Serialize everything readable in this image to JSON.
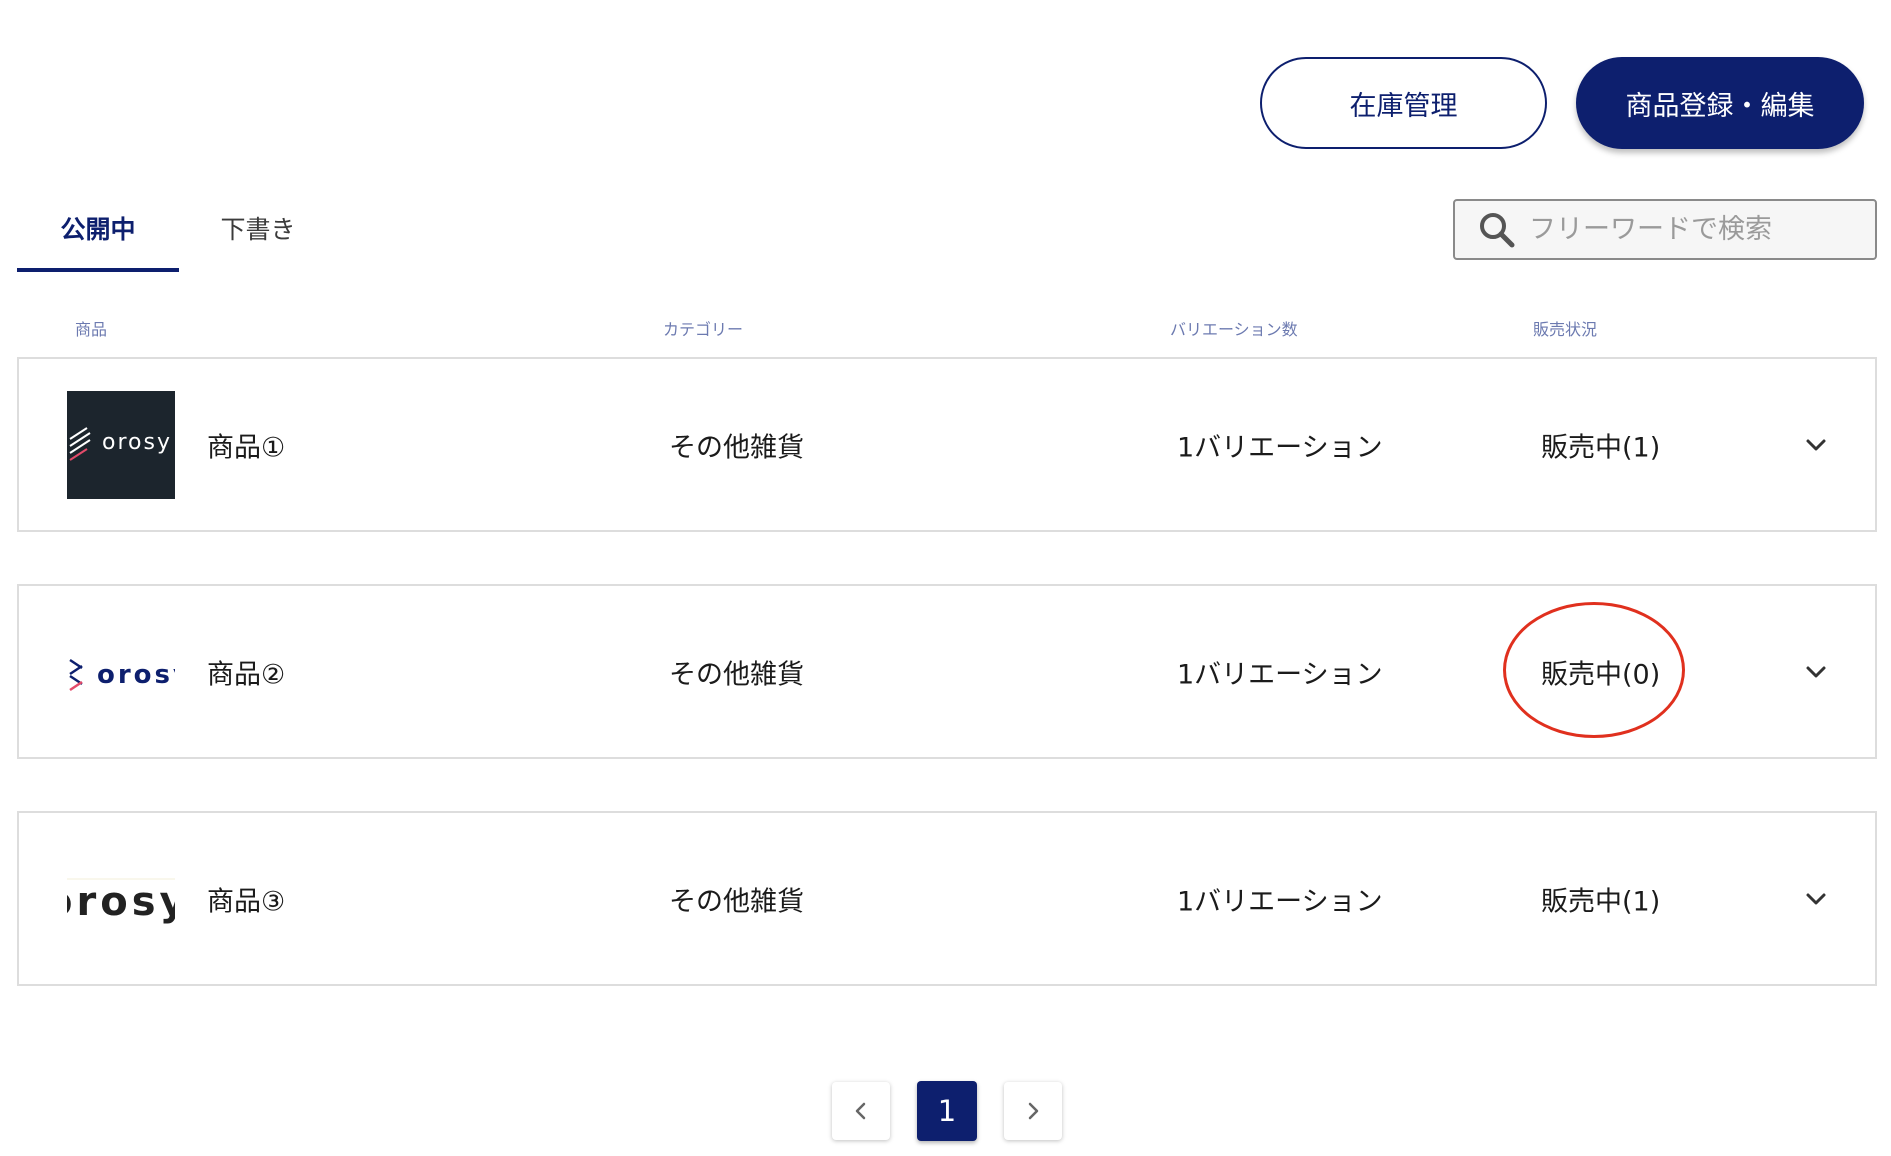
{
  "toolbar": {
    "inventory_label": "在庫管理",
    "register_edit_label": "商品登録・編集"
  },
  "tabs": [
    {
      "label": "公開中",
      "active": true
    },
    {
      "label": "下書き",
      "active": false
    }
  ],
  "search": {
    "placeholder": "フリーワードで検索",
    "value": ""
  },
  "columns": {
    "product": "商品",
    "category": "カテゴリー",
    "variations": "バリエーション数",
    "sales_status": "販売状況"
  },
  "products": [
    {
      "name": "商品①",
      "category": "その他雑貨",
      "variations": "1バリエーション",
      "status": "販売中(1)",
      "thumbnail_icon": "orosy-logo-dark"
    },
    {
      "name": "商品②",
      "category": "その他雑貨",
      "variations": "1バリエーション",
      "status": "販売中(0)",
      "thumbnail_icon": "orosy-logo-light",
      "highlighted": true
    },
    {
      "name": "商品③",
      "category": "その他雑貨",
      "variations": "1バリエーション",
      "status": "販売中(1)",
      "thumbnail_icon": "orosy-logo-cropped"
    }
  ],
  "thumbnails": {
    "logo_text": "orosy"
  },
  "pagination": {
    "current": "1"
  },
  "colors": {
    "primary": "#0d1f6e",
    "highlight": "#e0301e",
    "header_text": "#6c7ab0",
    "border": "#dddddd"
  }
}
